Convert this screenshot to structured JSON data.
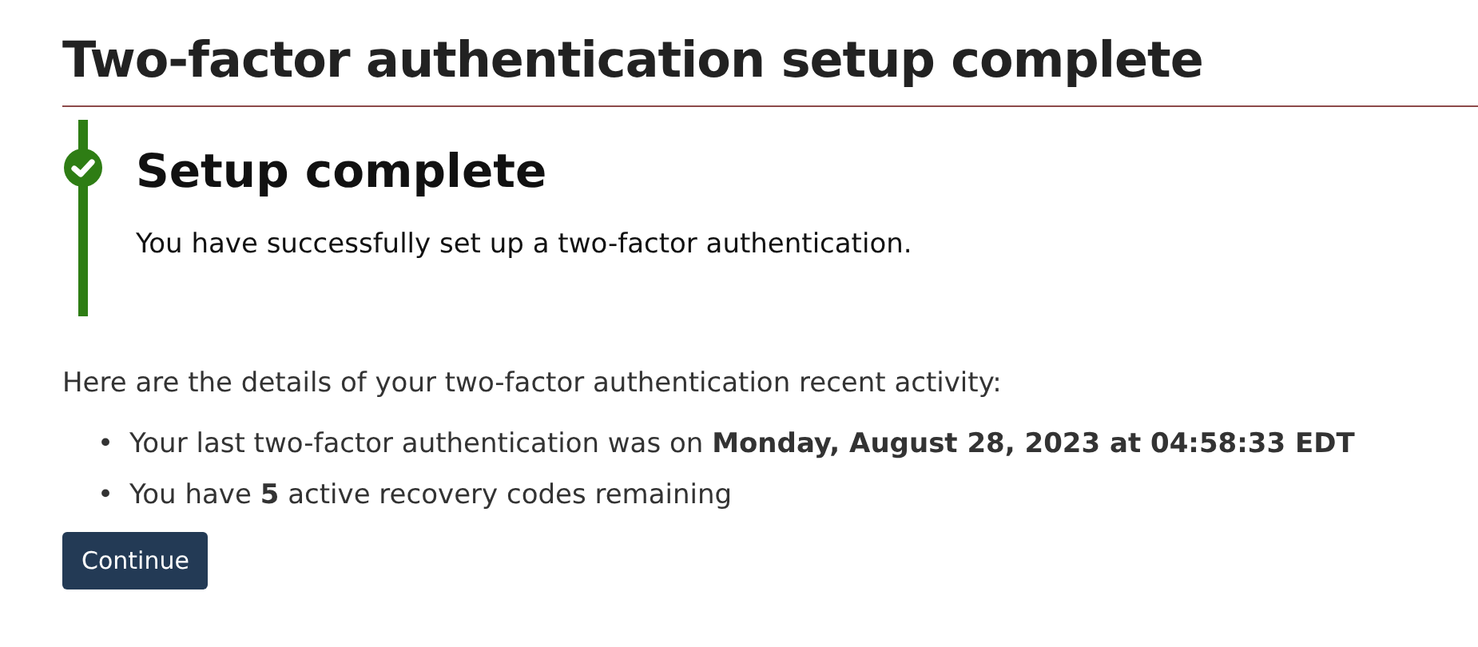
{
  "page": {
    "title": "Two-factor authentication setup complete"
  },
  "alert": {
    "kind": "success",
    "heading": "Setup complete",
    "message": "You have successfully set up a two-factor authentication."
  },
  "details": {
    "intro": "Here are the details of your two-factor authentication recent activity:",
    "items": [
      {
        "marker": "•",
        "text": "Your last two-factor authentication was on **Monday, August 28, 2023 at 04:58:33 EDT**"
      },
      {
        "marker": "•",
        "text": "You have **5** active recovery codes remaining"
      }
    ]
  },
  "buttons": [
    "Continue"
  ]
}
